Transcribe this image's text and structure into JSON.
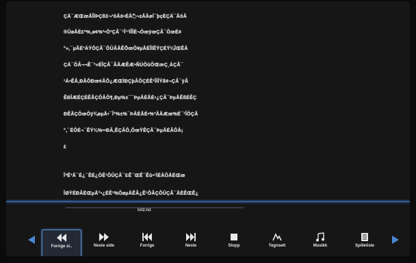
{
  "document": {
    "lines": [
      "ÇÄ¯ÆŒœÅÎÏÞÇßƐ¬³ŏÅö•ÉÅ߯¬±ÅÅøÍ¯þçÈÇÄ¯ÅŏÅ",
      "®ÛøÅÉ£ª%,ø¢%³•Ô³ÇÂ¯¹Î¹¹ÏÎÎÉ¬ÔœÿœÇÂ¯ÔœÉ#",
      "°»,¯µÃÉ³ÁŸÔÇÂ¯ÔÛÂÅÊÕœÔ¥µÅÉÎÏÊŸÇÉŸ¼ÎŒÊÅ",
      "ÇÄ¯ÔÂ¬¬Ê¯³»ÉÎÇÂ¯ÂÅÆÊÆ•ÑÜÔûÔŒœÇ¸ÁÇÂ¯",
      "¹Á•ÊÃ,ÐÂÔÐœ¢ÃÔ¿ÆŒÏÐÇþÂÔÇÉÊ¹ÎÏÎŸß¢¬ÇÂ¯ÿÃ",
      "ÊÐÎÆÉÇÉÊÃÇÔÅÔ¶,Ðµ%±¯¯ÞµÅÉÃÉ•¿ÇÂ¯ÞµÅÊßÉÊÇ",
      "ÐÊÃÇÔœÔÿ¾øµÅ•¯Î³%±%¯ÞÅÉÅÉ•%³ÂÅÆœ%É¯¹ÎÔÇÂ",
      "°,¯ÉÔÉ¬¯ÊŸ¼%••ÐÂ,ÊÇÂÔ,ÔœŸÊÇÂ¯ÞµÅÉÂÔÅ¡",
      "£",
      "ÎªÊ³Å¯É¿¯ÊÉ¿ÔÊ¹ÔÛÇÂ¯ƐÊ¯ŒÊ¯Êû•¹ÏÉÅÔÅÉŒœ",
      "ÎØŸÉÐÂÉŒµÅ°•¿ÉÊ¹%ÔøµÅÊÂ¿Ê¹ÔÂÇÔÛÇÂ¯ÅÉÊŒÊ¿"
    ]
  },
  "player": {
    "filename": "txt2.txt",
    "progress": 0.0
  },
  "toolbar": {
    "buttons": [
      {
        "label": "Forrige si..",
        "icon": "rewind-icon",
        "selected": true
      },
      {
        "label": "Neste side",
        "icon": "fast-forward-icon",
        "selected": false
      },
      {
        "label": "Forrige",
        "icon": "skip-previous-icon",
        "selected": false
      },
      {
        "label": "Neste",
        "icon": "skip-next-icon",
        "selected": false
      },
      {
        "label": "Stopp",
        "icon": "stop-icon",
        "selected": false
      },
      {
        "label": "Tegnsett",
        "icon": "font-icon",
        "selected": false
      },
      {
        "label": "Musikk",
        "icon": "music-note-icon",
        "selected": false
      },
      {
        "label": "Spilleliste",
        "icon": "playlist-icon",
        "selected": false
      }
    ],
    "left_arrow_icon": "arrow-left-icon",
    "right_arrow_icon": "arrow-right-icon",
    "accent_color": "#4a86d4"
  }
}
